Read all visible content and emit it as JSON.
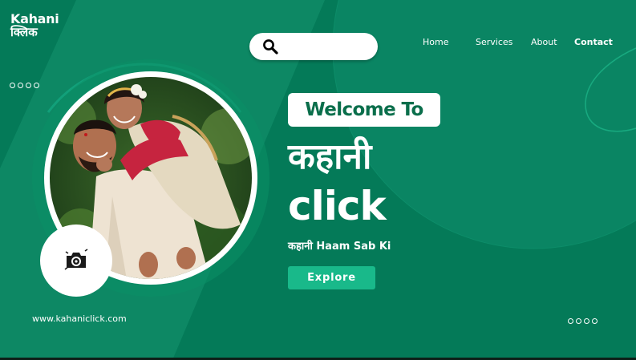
{
  "brand": {
    "name_line1": "Kahani",
    "name_line2": "क्लिक"
  },
  "search": {
    "placeholder": ""
  },
  "nav": {
    "home": "Home",
    "services": "Services",
    "about": "About",
    "contact": "Contact"
  },
  "hero": {
    "welcome": "Welcome To",
    "title_hindi": "कहानी",
    "title_click": "click",
    "tagline": "कहानी Haam Sab Ki",
    "cta": "Explore"
  },
  "footer": {
    "website": "www.kahaniclick.com"
  },
  "colors": {
    "background": "#047a58",
    "accent": "#19b98a",
    "welcome_text": "#0a6e4b",
    "white": "#ffffff"
  },
  "icons": {
    "search": "search-icon",
    "camera": "camera-icon",
    "dots": "pagination-dots"
  }
}
